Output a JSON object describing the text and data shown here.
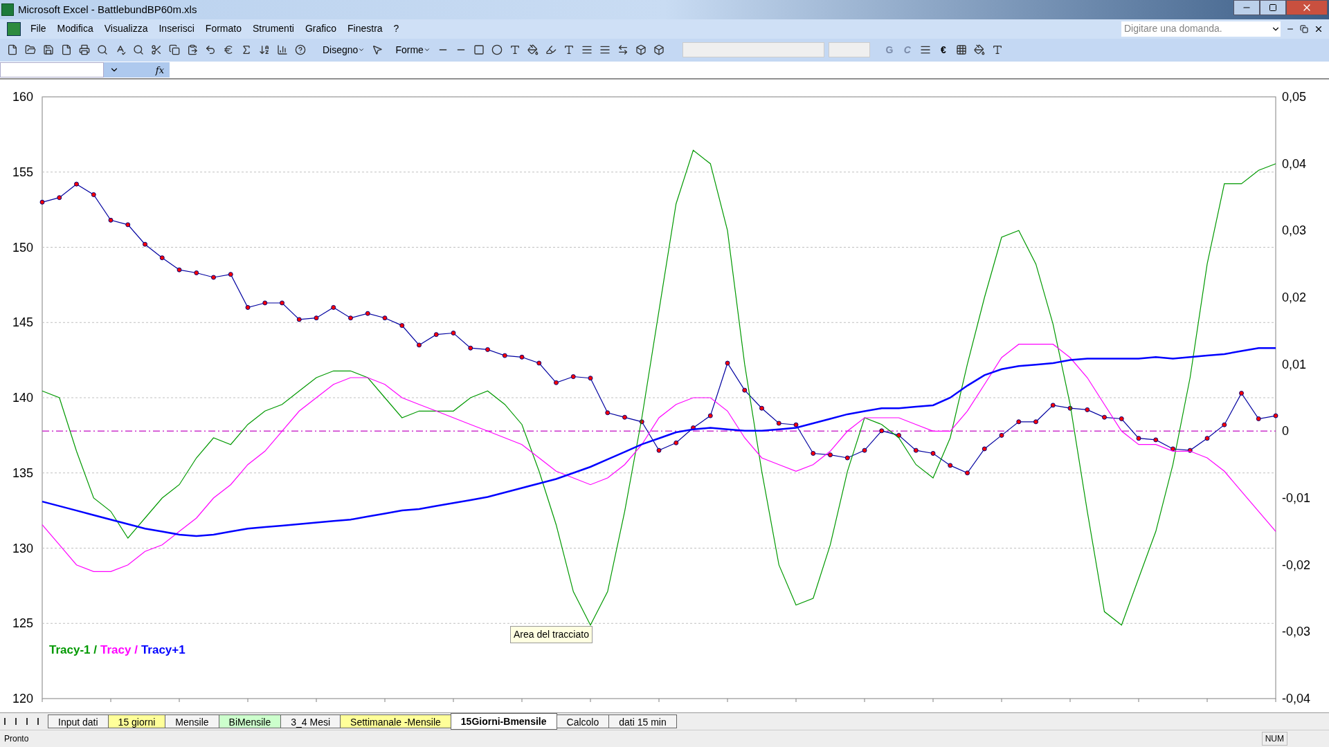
{
  "window": {
    "title": "Microsoft Excel - BattlebundBP60m.xls"
  },
  "menu": [
    "File",
    "Modifica",
    "Visualizza",
    "Inserisci",
    "Formato",
    "Strumenti",
    "Grafico",
    "Finestra",
    "?"
  ],
  "help_search": {
    "placeholder": "Digitare una domanda."
  },
  "toolbar": {
    "drawing_menu": "Disegno",
    "shapes_menu": "Forme",
    "bold": "G",
    "italic": "C",
    "euro": "€"
  },
  "formula_bar": {
    "function_label": "fx"
  },
  "chart": {
    "legend_separator": "/",
    "tooltip": "Area del tracciato",
    "chart_data": {
      "type": "line",
      "ylim": [
        120,
        160
      ],
      "yticks": [
        120,
        125,
        130,
        135,
        140,
        145,
        150,
        155,
        160
      ],
      "y2lim": [
        -0.04,
        0.05
      ],
      "y2ticks": [
        {
          "value": -0.04,
          "label": "-0,04"
        },
        {
          "value": -0.03,
          "label": "-0,03"
        },
        {
          "value": -0.02,
          "label": "-0,02"
        },
        {
          "value": -0.01,
          "label": "-0,01"
        },
        {
          "value": 0,
          "label": "0"
        },
        {
          "value": 0.01,
          "label": "0,01"
        },
        {
          "value": 0.02,
          "label": "0,02"
        },
        {
          "value": 0.03,
          "label": "0,03"
        },
        {
          "value": 0.04,
          "label": "0,04"
        },
        {
          "value": 0.05,
          "label": "0,05"
        }
      ],
      "grid": true,
      "ref_lines": [
        {
          "value": 0,
          "axis": "y2"
        }
      ],
      "series": [
        {
          "color": "#0000a0",
          "marker": "o",
          "values": [
            153,
            153.3,
            154.2,
            153.5,
            151.8,
            151.5,
            150.2,
            149.3,
            148.5,
            148.3,
            148,
            148.2,
            146,
            146.3,
            146.3,
            145.2,
            145.3,
            146,
            145.3,
            145.6,
            145.3,
            144.8,
            143.5,
            144.2,
            144.3,
            143.3,
            143.2,
            142.8,
            142.7,
            142.3,
            141,
            141.4,
            141.3,
            139,
            138.7,
            138.4,
            136.5,
            137,
            138,
            138.8,
            142.3,
            140.5,
            139.3,
            138.3,
            138.2,
            136.3,
            136.2,
            136,
            136.5,
            137.8,
            137.5,
            136.5,
            136.3,
            135.5,
            135,
            136.6,
            137.5,
            138.4,
            138.4,
            139.5,
            139.3,
            139.2,
            138.7,
            138.6,
            137.3,
            137.2,
            136.6,
            136.5,
            137.3,
            138.2,
            140.3,
            138.6,
            138.8
          ]
        },
        {
          "name": "Tracy-1",
          "color": "#009900",
          "axis": "y2",
          "values": [
            0.006,
            0.005,
            -0.003,
            -0.01,
            -0.012,
            -0.016,
            -0.013,
            -0.01,
            -0.008,
            -0.004,
            -0.001,
            -0.002,
            0.001,
            0.003,
            0.004,
            0.006,
            0.008,
            0.009,
            0.009,
            0.008,
            0.005,
            0.002,
            0.003,
            0.003,
            0.003,
            0.005,
            0.006,
            0.004,
            0.001,
            -0.006,
            -0.014,
            -0.024,
            -0.029,
            -0.024,
            -0.012,
            0.002,
            0.018,
            0.034,
            0.042,
            0.04,
            0.03,
            0.01,
            -0.006,
            -0.02,
            -0.026,
            -0.025,
            -0.017,
            -0.006,
            0.002,
            0.001,
            -0.001,
            -0.005,
            -0.007,
            -0.001,
            0.01,
            0.02,
            0.029,
            0.03,
            0.025,
            0.016,
            0.004,
            -0.012,
            -0.027,
            -0.029,
            -0.022,
            -0.015,
            -0.005,
            0.008,
            0.025,
            0.037,
            0.037,
            0.039,
            0.04
          ]
        },
        {
          "name": "Tracy",
          "color": "#ff00ff",
          "axis": "y2",
          "values": [
            -0.014,
            -0.017,
            -0.02,
            -0.021,
            -0.021,
            -0.02,
            -0.018,
            -0.017,
            -0.015,
            -0.013,
            -0.01,
            -0.008,
            -0.005,
            -0.003,
            0,
            0.003,
            0.005,
            0.007,
            0.008,
            0.008,
            0.007,
            0.005,
            0.004,
            0.003,
            0.002,
            0.001,
            0,
            -0.001,
            -0.002,
            -0.004,
            -0.006,
            -0.007,
            -0.008,
            -0.007,
            -0.005,
            -0.002,
            0.002,
            0.004,
            0.005,
            0.005,
            0.003,
            -0.001,
            -0.004,
            -0.005,
            -0.006,
            -0.005,
            -0.003,
            0,
            0.002,
            0.002,
            0.002,
            0.001,
            0,
            0,
            0.003,
            0.007,
            0.011,
            0.013,
            0.013,
            0.013,
            0.011,
            0.008,
            0.004,
            0,
            -0.002,
            -0.002,
            -0.003,
            -0.003,
            -0.004,
            -0.006,
            -0.009,
            -0.012,
            -0.015
          ]
        },
        {
          "name": "Tracy+1",
          "color": "#0000ff",
          "values": [
            133.1,
            132.8,
            132.5,
            132.2,
            131.9,
            131.6,
            131.3,
            131.1,
            130.9,
            130.8,
            130.9,
            131.1,
            131.3,
            131.4,
            131.5,
            131.6,
            131.7,
            131.8,
            131.9,
            132.1,
            132.3,
            132.5,
            132.6,
            132.8,
            133,
            133.2,
            133.4,
            133.7,
            134,
            134.3,
            134.6,
            135,
            135.4,
            135.9,
            136.4,
            136.9,
            137.3,
            137.7,
            137.9,
            138,
            137.9,
            137.8,
            137.8,
            137.9,
            138,
            138.3,
            138.6,
            138.9,
            139.1,
            139.3,
            139.3,
            139.4,
            139.5,
            140,
            140.8,
            141.5,
            141.9,
            142.1,
            142.2,
            142.3,
            142.5,
            142.6,
            142.6,
            142.6,
            142.6,
            142.7,
            142.6,
            142.7,
            142.8,
            142.9,
            143.1,
            143.3,
            143.3
          ]
        }
      ]
    }
  },
  "sheet_tabs": [
    {
      "label": "Input dati",
      "selected": false
    },
    {
      "label": "15 giorni",
      "selected": false,
      "color": "#ffff99"
    },
    {
      "label": "Mensile",
      "selected": false
    },
    {
      "label": "BiMensile",
      "selected": false,
      "color": "#ccffcc"
    },
    {
      "label": "3_4 Mesi",
      "selected": false
    },
    {
      "label": "Settimanale -Mensile",
      "selected": false,
      "color": "#ffff99"
    },
    {
      "label": "15Giorni-Bmensile",
      "selected": true
    },
    {
      "label": "Calcolo",
      "selected": false
    },
    {
      "label": "dati 15 min",
      "selected": false
    }
  ],
  "status_bar": {
    "status": "Pronto",
    "num_lock": "NUM"
  }
}
